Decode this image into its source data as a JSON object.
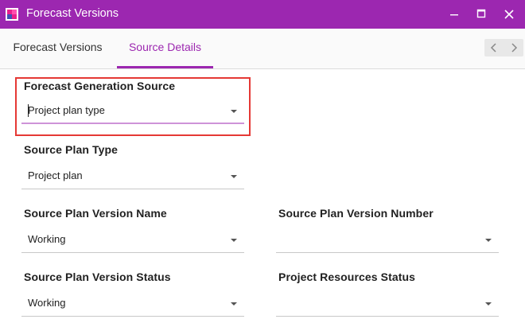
{
  "window": {
    "title": "Forecast Versions",
    "accent_color": "#9c27b0"
  },
  "tabs": [
    {
      "label": "Forecast Versions",
      "active": false
    },
    {
      "label": "Source Details",
      "active": true
    }
  ],
  "fields": {
    "forecast_generation_source": {
      "label": "Forecast Generation Source",
      "value": "Project plan type"
    },
    "source_plan_type": {
      "label": "Source Plan Type",
      "value": "Project plan"
    },
    "source_plan_version_name": {
      "label": "Source Plan Version Name",
      "value": "Working"
    },
    "source_plan_version_number": {
      "label": "Source Plan Version Number",
      "value": ""
    },
    "source_plan_version_status": {
      "label": "Source Plan Version Status",
      "value": "Working"
    },
    "project_resources_status": {
      "label": "Project Resources Status",
      "value": ""
    }
  },
  "icons": {
    "app": "app-icon",
    "minimize": "minimize-icon",
    "maximize": "maximize-icon",
    "close": "close-icon",
    "nav_prev": "chevron-left-icon",
    "nav_next": "chevron-right-icon",
    "dropdown": "caret-down-icon"
  },
  "highlight_color": "#e53935"
}
